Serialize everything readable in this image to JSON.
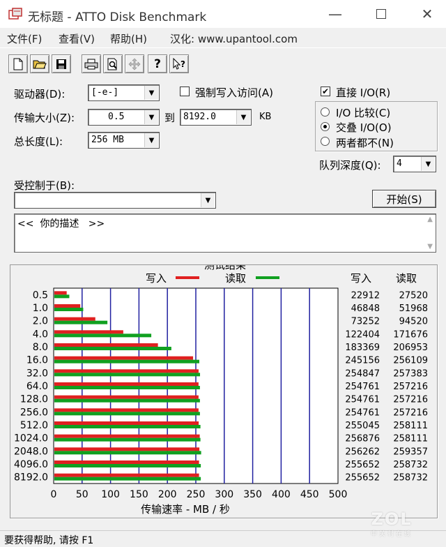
{
  "window": {
    "title": "无标题 - ATTO Disk Benchmark"
  },
  "menu": {
    "file": "文件(F)",
    "view": "查看(V)",
    "help": "帮助(H)",
    "localized": "汉化: www.upantool.com"
  },
  "toolbar": {
    "icons": [
      "new-icon",
      "open-icon",
      "save-icon",
      "print-icon",
      "print-preview-icon",
      "move-icon",
      "help-icon",
      "context-help-icon"
    ]
  },
  "form": {
    "drive_label": "驱动器(D):",
    "drive_value": "[-e-]",
    "force_write_label": "强制写入访问(A)",
    "transfer_label": "传输大小(Z):",
    "transfer_from": "0.5",
    "to_label": "到",
    "transfer_to": "8192.0",
    "kb_label": "KB",
    "total_label": "总长度(L):",
    "total_value": "256 MB",
    "direct_io_label": "直接 I/O(R)",
    "io_compare_label": "I/O 比较(C)",
    "io_overlap_label": "交叠 I/O(O)",
    "neither_label": "两者都不(N)",
    "queue_label": "队列深度(Q):",
    "queue_value": "4",
    "controlled_label": "受控制于(B):",
    "controlled_value": "",
    "start_label": "开始(S)",
    "description": "<<  你的描述   >>"
  },
  "results": {
    "title": "测试结果",
    "write_legend": "写入",
    "read_legend": "读取",
    "write_header": "写入",
    "read_header": "读取",
    "write_color": "#e02020",
    "read_color": "#10a020",
    "xlabel": "传输速率 - MB / 秒"
  },
  "chart_data": {
    "type": "bar",
    "orientation": "horizontal",
    "categories": [
      "0.5",
      "1.0",
      "2.0",
      "4.0",
      "8.0",
      "16.0",
      "32.0",
      "64.0",
      "128.0",
      "256.0",
      "512.0",
      "1024.0",
      "2048.0",
      "4096.0",
      "8192.0"
    ],
    "series": [
      {
        "name": "写入",
        "values": [
          22912,
          46848,
          73252,
          122404,
          183369,
          245156,
          254847,
          254761,
          254761,
          254761,
          255045,
          256876,
          256262,
          255652,
          255652
        ]
      },
      {
        "name": "读取",
        "values": [
          27520,
          51968,
          94520,
          171676,
          206953,
          256109,
          257383,
          257216,
          257216,
          257216,
          258111,
          258111,
          259357,
          258732,
          258732
        ]
      }
    ],
    "xticks": [
      "0",
      "50",
      "100",
      "150",
      "200",
      "250",
      "300",
      "350",
      "400",
      "450",
      "500"
    ],
    "xlim": [
      0,
      500
    ],
    "xlabel": "传输速率 - MB / 秒",
    "grid": true
  },
  "status": {
    "text": "要获得帮助, 请按 F1"
  },
  "watermark": {
    "text": "ZOL",
    "sub": "中关村在线"
  }
}
